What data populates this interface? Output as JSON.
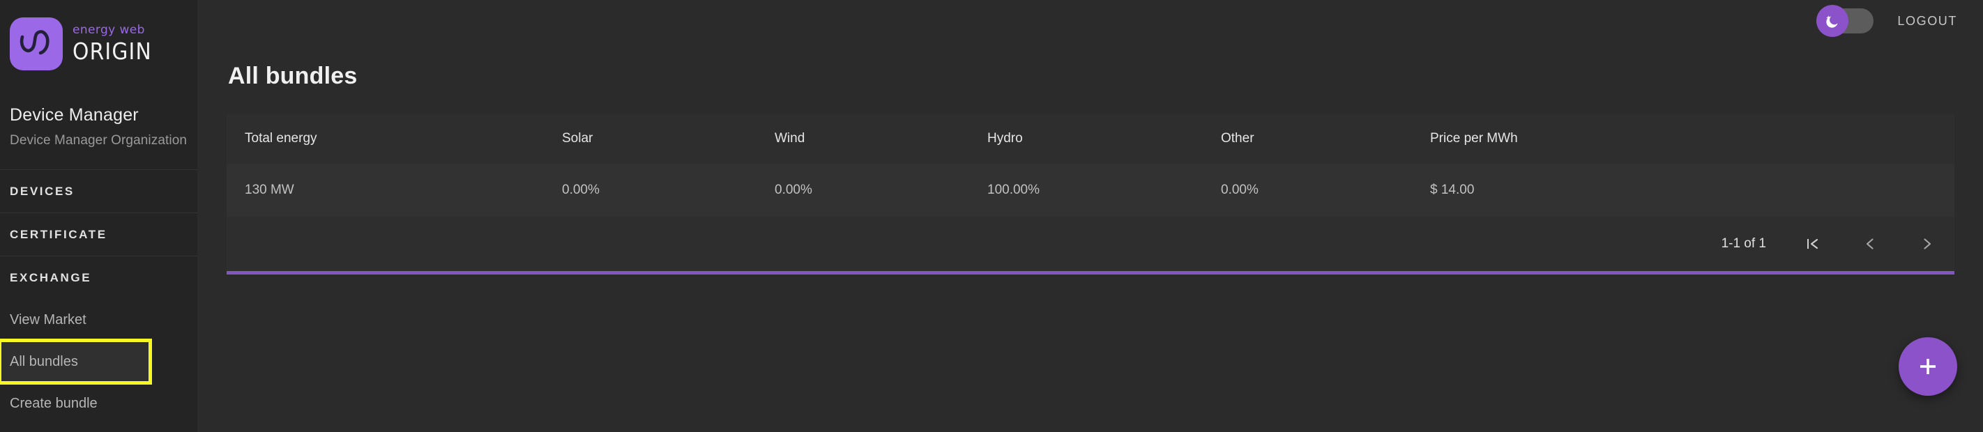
{
  "brand": {
    "top_label": "energy web",
    "main_label": "ORIGIN",
    "mark_icon": "energy-web-swirl-icon"
  },
  "sidebar": {
    "org_name": "Device Manager",
    "org_subtitle": "Device Manager Organization",
    "sections": [
      {
        "label": "DEVICES"
      },
      {
        "label": "CERTIFICATE"
      },
      {
        "label": "EXCHANGE"
      }
    ],
    "links": [
      {
        "label": "View Market",
        "selected": false,
        "highlighted": false
      },
      {
        "label": "All bundles",
        "selected": true,
        "highlighted": true
      },
      {
        "label": "Create bundle",
        "selected": false,
        "highlighted": false
      }
    ]
  },
  "topbar": {
    "theme_toggle": {
      "icon": "moon-icon",
      "state": "on"
    },
    "logout_label": "LOGOUT"
  },
  "main": {
    "page_title": "All bundles",
    "table": {
      "columns": [
        "Total energy",
        "Solar",
        "Wind",
        "Hydro",
        "Other",
        "Price per MWh"
      ],
      "rows": [
        [
          "130 MW",
          "0.00%",
          "0.00%",
          "100.00%",
          "0.00%",
          "$ 14.00"
        ]
      ]
    },
    "pagination": {
      "range_label": "1-1 of 1",
      "first_page_icon": "first-page-icon",
      "prev_page_icon": "chevron-left-icon",
      "next_page_icon": "chevron-right-icon"
    },
    "fab": {
      "icon": "plus-icon"
    }
  },
  "colors": {
    "accent": "#8b52c9",
    "brand_purple": "#9b68e8",
    "rule_purple": "#8357c0",
    "highlight_yellow": "#f7f725",
    "sidebar_bg": "#242424",
    "page_bg": "#2b2b2b",
    "row_bg": "#323232",
    "header_bg": "#2e2e2e"
  }
}
